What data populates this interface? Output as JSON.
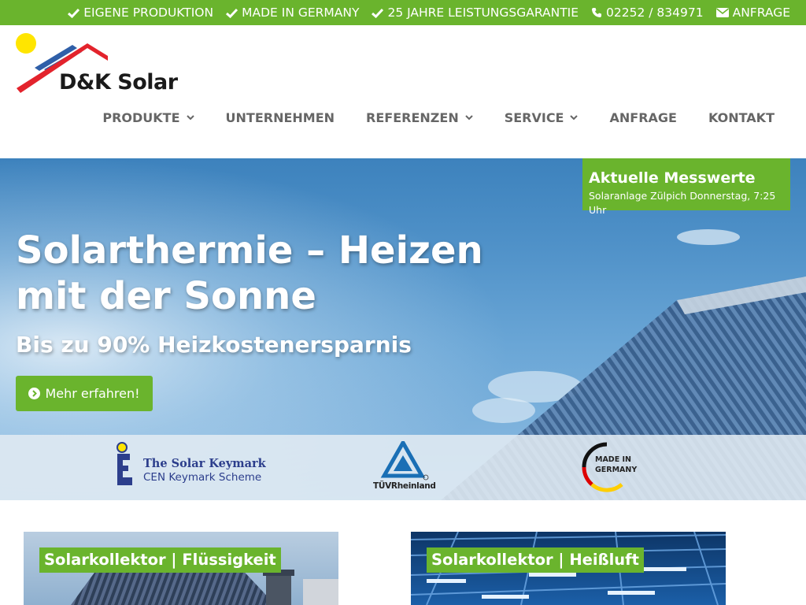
{
  "topbar": {
    "items": [
      {
        "icon": "check-icon",
        "label": "EIGENE PRODUKTION"
      },
      {
        "icon": "check-icon",
        "label": "MADE IN GERMANY"
      },
      {
        "icon": "check-icon",
        "label": "25 JAHRE LEISTUNGSGARANTIE"
      },
      {
        "icon": "phone-icon",
        "label": "02252 / 834971"
      },
      {
        "icon": "envelope-icon",
        "label": "ANFRAGE"
      }
    ]
  },
  "logo": {
    "text": "D&K Solar"
  },
  "nav": {
    "items": [
      {
        "label": "PRODUKTE",
        "dropdown": true
      },
      {
        "label": "UNTERNEHMEN",
        "dropdown": false
      },
      {
        "label": "REFERENZEN",
        "dropdown": true
      },
      {
        "label": "SERVICE",
        "dropdown": true
      },
      {
        "label": "ANFRAGE",
        "dropdown": false
      },
      {
        "label": "KONTAKT",
        "dropdown": false
      }
    ]
  },
  "hero": {
    "title": "Solarthermie – Heizen mit der Sonne",
    "subtitle": "Bis zu 90% Heizkostenersparnis",
    "button_label": "Mehr erfahren!"
  },
  "messwerte": {
    "title": "Aktuelle Messwerte",
    "subtitle": "Solaranlage Zülpich Donnerstag, 7:25 Uhr"
  },
  "certs": {
    "keymark_line1": "The Solar Keymark",
    "keymark_line2": "CEN Keymark Scheme",
    "tuv_text": "TÜVRheinland",
    "mig_line1": "MADE IN",
    "mig_line2": "GERMANY"
  },
  "cards": [
    {
      "label": "Solarkollektor | Flüssigkeit"
    },
    {
      "label": "Solarkollektor | Heißluft"
    }
  ],
  "colors": {
    "brand_green": "#6ab42d",
    "nav_text": "#666666",
    "logo_red": "#e3232c",
    "logo_blue": "#2f5fa8",
    "logo_sun": "#ffe500"
  }
}
